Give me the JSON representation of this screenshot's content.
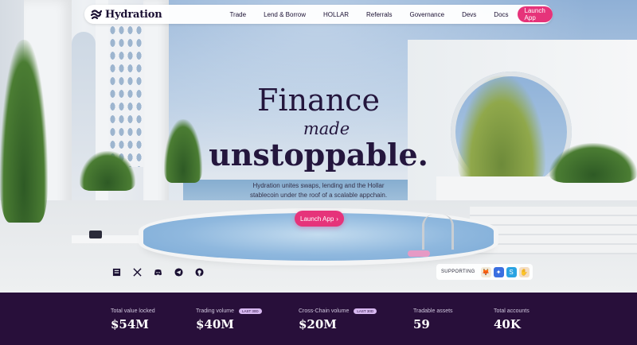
{
  "nav": {
    "brand": "Hydration",
    "links": [
      "Trade",
      "Lend & Borrow",
      "HOLLAR",
      "Referrals",
      "Governance",
      "Devs",
      "Docs"
    ],
    "cta": "Launch App"
  },
  "hero": {
    "line1": "Finance",
    "line2": "made",
    "line3": "unstoppable.",
    "subtitle_line1": "Hydration unites swaps, lending and the Hollar",
    "subtitle_line2": "stablecoin under the roof of a scalable appchain.",
    "cta": "Launch App",
    "cta_arrow": "›"
  },
  "social": [
    {
      "name": "medium",
      "label": "Medium"
    },
    {
      "name": "x",
      "label": "X"
    },
    {
      "name": "discord",
      "label": "Discord"
    },
    {
      "name": "telegram",
      "label": "Telegram"
    },
    {
      "name": "github",
      "label": "GitHub"
    }
  ],
  "supporting": {
    "label": "SUPPORTING",
    "wallets": [
      {
        "name": "metamask",
        "color": "#f3ead8",
        "glyph": "🦊"
      },
      {
        "name": "nova",
        "color": "#3b6fe0",
        "glyph": "✦"
      },
      {
        "name": "subwallet",
        "color": "#2aa3e2",
        "glyph": "S"
      },
      {
        "name": "talisman",
        "color": "#f4ddc2",
        "glyph": "✋"
      }
    ]
  },
  "stats": [
    {
      "label": "Total value locked",
      "tag": "",
      "value": "$54M"
    },
    {
      "label": "Trading volume",
      "tag": "LAST 30D",
      "value": "$40M"
    },
    {
      "label": "Cross-Chain volume",
      "tag": "LAST 30D",
      "value": "$20M"
    },
    {
      "label": "Tradable assets",
      "tag": "",
      "value": "59"
    },
    {
      "label": "Total accounts",
      "tag": "",
      "value": "40K"
    }
  ],
  "colors": {
    "accent": "#e6337a",
    "ink": "#24163d",
    "stats_bg": "#280f3a"
  }
}
